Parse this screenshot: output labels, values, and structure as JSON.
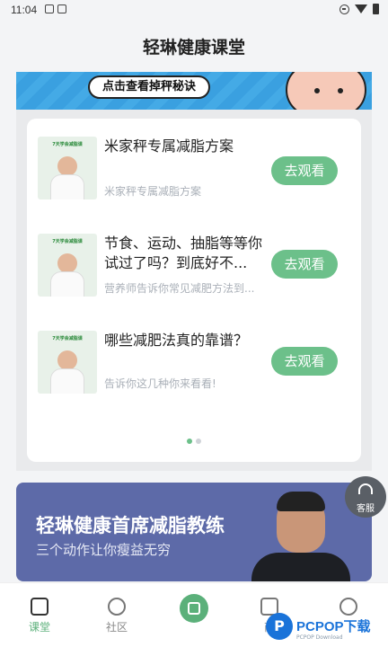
{
  "status": {
    "time": "11:04"
  },
  "header": {
    "title": "轻琳健康课堂"
  },
  "banner": {
    "text": "点击查看掉秤秘诀"
  },
  "courses": [
    {
      "title": "米家秤专属减脂方案",
      "subtitle": "米家秤专属减脂方案",
      "button": "去观看",
      "thumb_text": "7天学会减脂课"
    },
    {
      "title": "节食、运动、抽脂等等你试过了吗？到底好不...",
      "subtitle": "营养师告诉你常见减肥方法到...",
      "button": "去观看",
      "thumb_text": "7天学会减脂课"
    },
    {
      "title": "哪些减肥法真的靠谱？",
      "subtitle": "告诉你这几种你来看看!",
      "button": "去观看",
      "thumb_text": "7天学会减脂课"
    }
  ],
  "pager": {
    "count": 2,
    "active": 1
  },
  "coach": {
    "title": "轻琳健康首席减脂教练",
    "subtitle": "三个动作让你瘦益无穷"
  },
  "float_button": {
    "label": "客服"
  },
  "tabs": [
    {
      "label": "课堂",
      "icon": "book-icon",
      "active": true
    },
    {
      "label": "社区",
      "icon": "chat-icon",
      "active": false
    },
    {
      "label": "",
      "icon": "scale-icon",
      "active": false
    },
    {
      "label": "商",
      "icon": "shop-icon",
      "active": false
    },
    {
      "label": "",
      "icon": "user-icon",
      "active": false
    }
  ],
  "watermark": {
    "logo": "P",
    "text": "PCPOP下载",
    "small": "PCPOP Download"
  },
  "colors": {
    "accent": "#6cc08a",
    "coach_bg": "#5d6aa8",
    "banner_bg": "#3aa0e0"
  }
}
